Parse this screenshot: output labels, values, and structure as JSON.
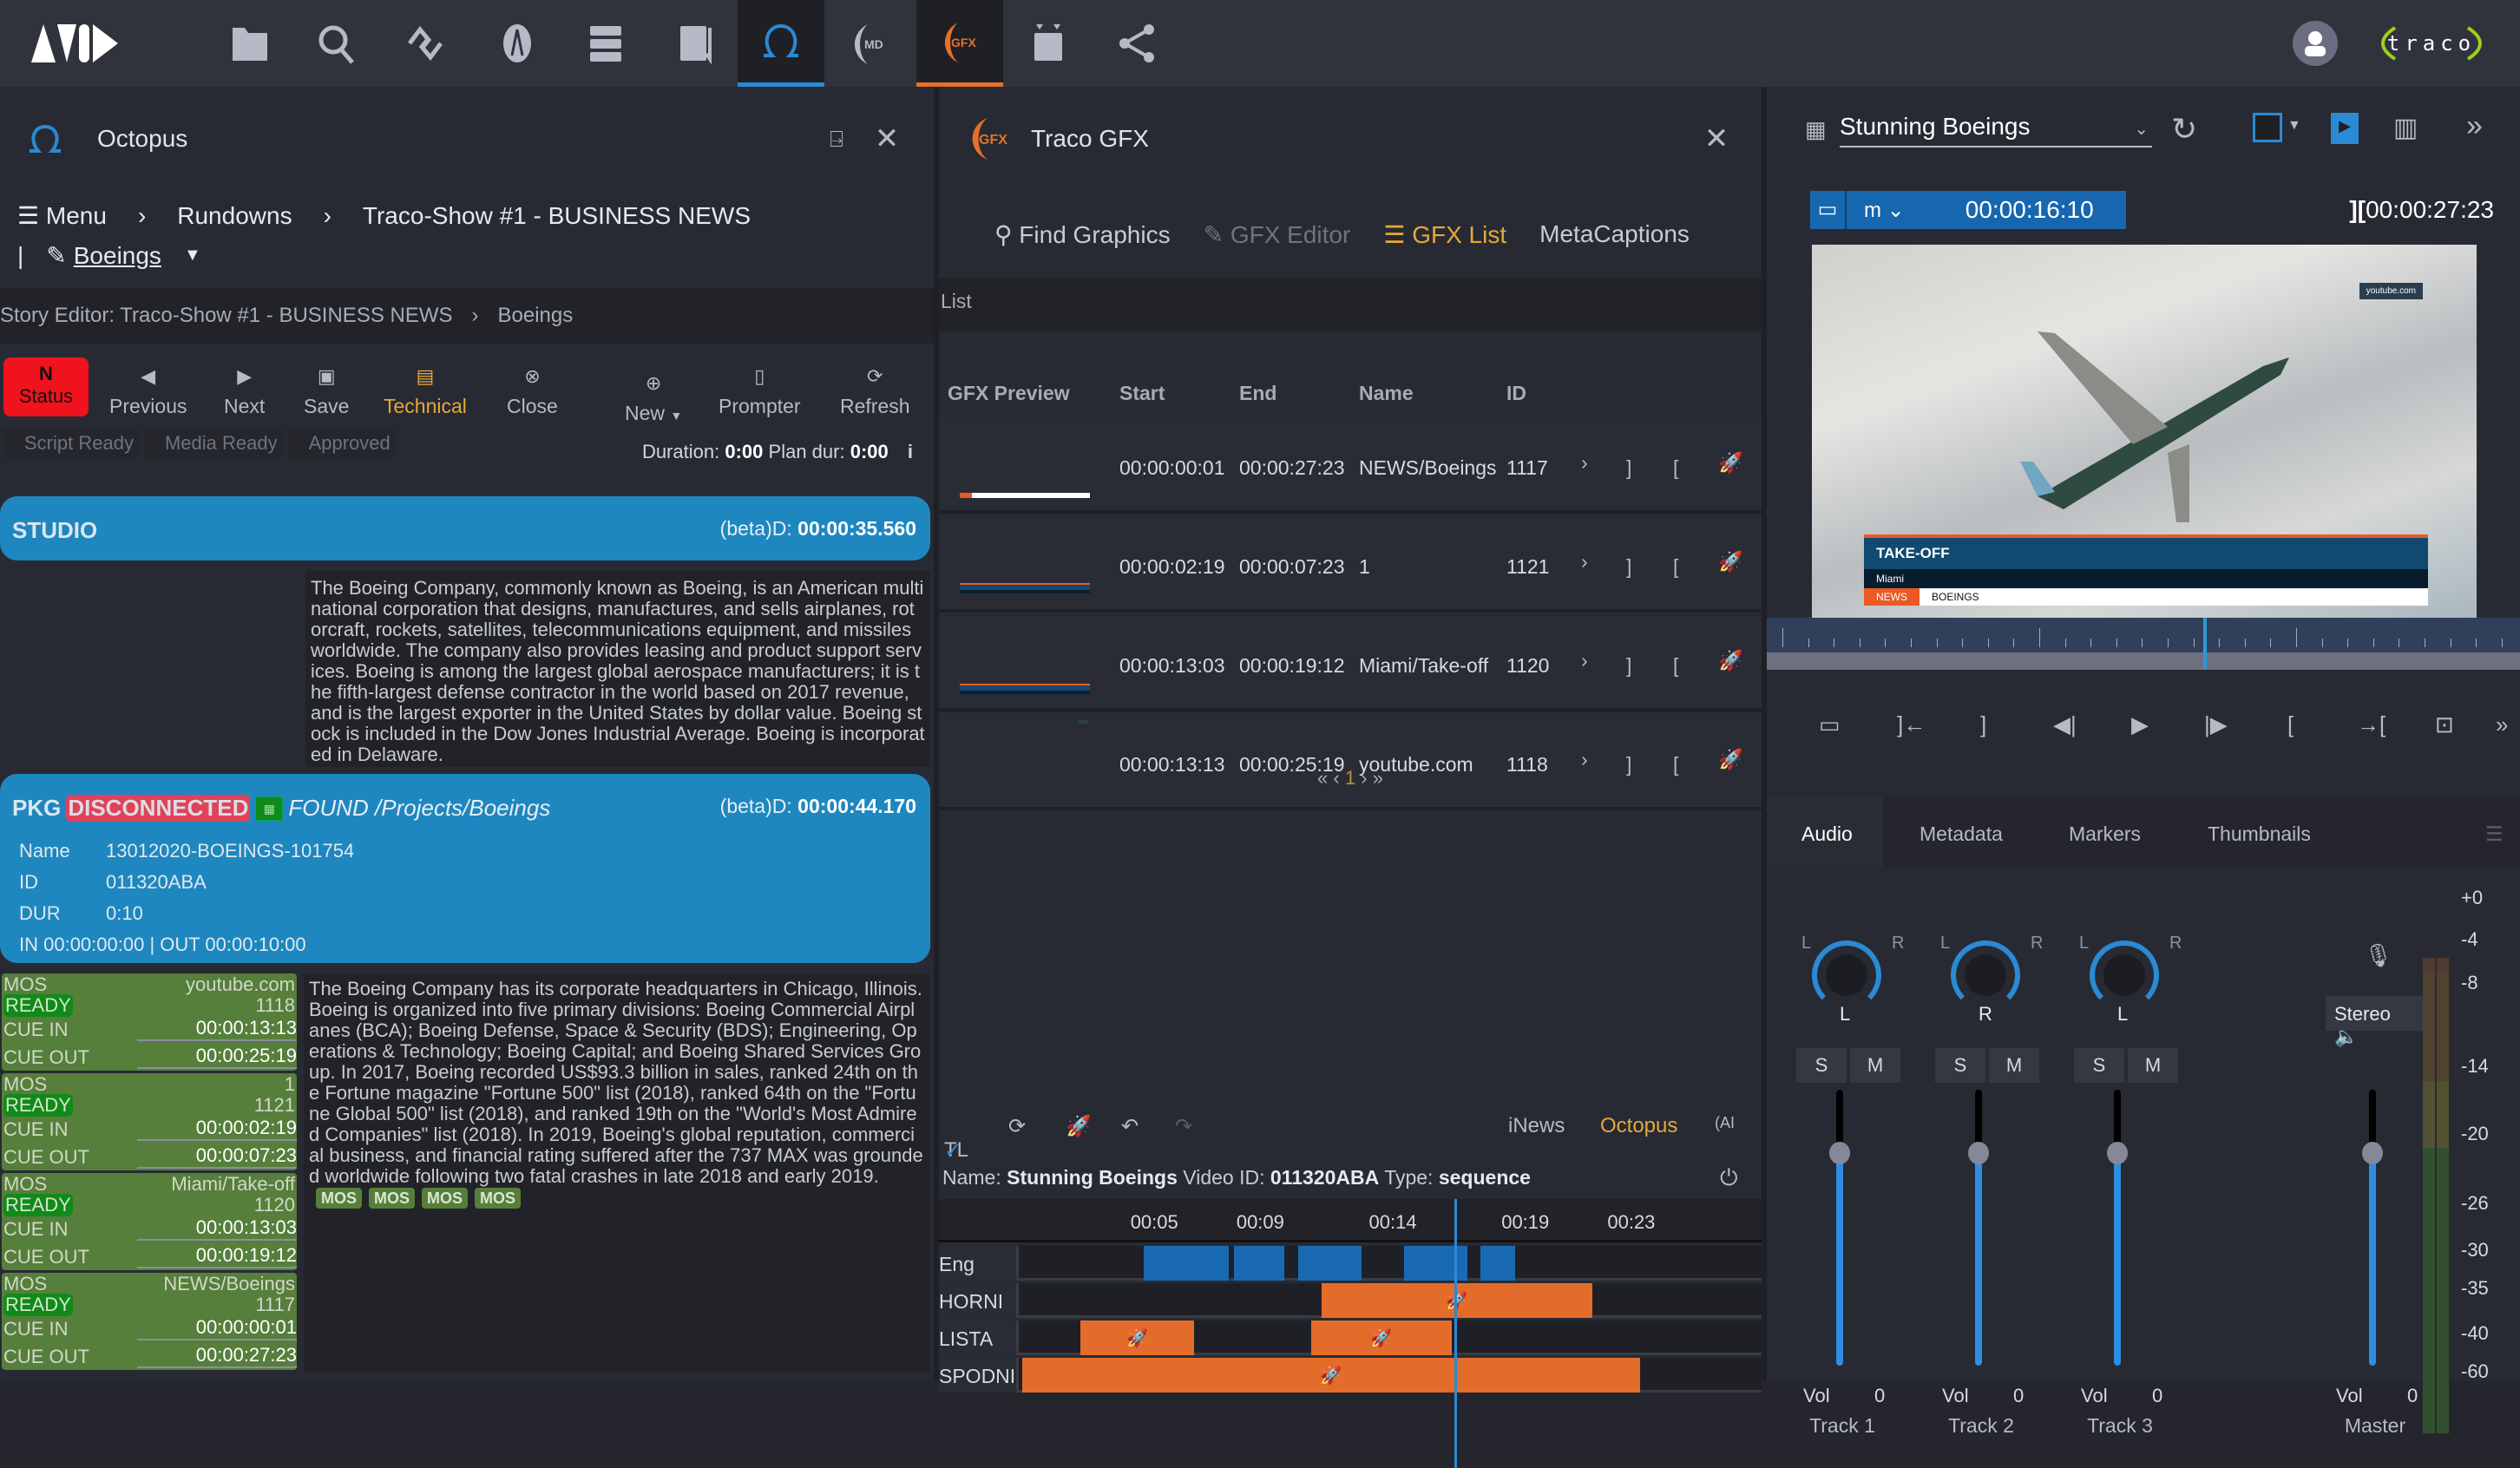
{
  "topbar": {
    "logo": "AVID",
    "nav_icons": [
      {
        "name": "folder-icon"
      },
      {
        "name": "search-icon"
      },
      {
        "name": "link-icon"
      },
      {
        "name": "rocket-icon"
      },
      {
        "name": "storage-icon"
      },
      {
        "name": "log-icon"
      },
      {
        "name": "octopus-icon",
        "active": true,
        "accent": "#2a8ad4"
      },
      {
        "name": "md-icon",
        "label": "MD"
      },
      {
        "name": "gfx-icon",
        "label": "GFX",
        "active": true,
        "accent": "#e4702a"
      },
      {
        "name": "sequence-icon"
      },
      {
        "name": "share-icon"
      }
    ],
    "brand": "traco"
  },
  "octopus": {
    "title": "Octopus",
    "breadcrumb": {
      "menu": "Menu",
      "rundowns": "Rundowns",
      "show": "Traco-Show #1 - BUSINESS NEWS",
      "story": "Boeings"
    },
    "story_editor": {
      "label": "Story Editor: Traco-Show #1 - BUSINESS NEWS",
      "story": "Boeings"
    },
    "toolbar": {
      "status": {
        "letter": "N",
        "label": "Status"
      },
      "previous": "Previous",
      "next": "Next",
      "save": "Save",
      "technical": "Technical",
      "close": "Close",
      "new": "New",
      "prompter": "Prompter",
      "refresh": "Refresh"
    },
    "chips": [
      "Script Ready",
      "Media Ready",
      "Approved"
    ],
    "duration": {
      "label": "Duration:",
      "value": "0:00",
      "plan_label": "Plan dur:",
      "plan_value": "0:00"
    },
    "studio": {
      "title": "STUDIO",
      "beta_label": "(beta)D:",
      "beta_value": "00:00:35.560"
    },
    "script1": "The Boeing Company, commonly known as Boeing, is an American multinational corporation that designs, manufactures, and sells airplanes, rotorcraft, rockets, satellites, telecommunications equipment, and missiles worldwide. The company also provides leasing and product support services. Boeing is among the largest global aerospace manufacturers; it is the fifth-largest defense contractor in the world based on 2017 revenue, and is the largest exporter in the United States by dollar value. Boeing stock is included in the Dow Jones Industrial Average. Boeing is incorporated in Delaware.",
    "pkg": {
      "type": "PKG",
      "status": "DISCONNECTED",
      "found": "FOUND /Projects/Boeings",
      "beta_label": "(beta)D:",
      "beta_value": "00:00:44.170",
      "fields": [
        {
          "k": "Name",
          "v": "13012020-BOEINGS-101754"
        },
        {
          "k": "ID",
          "v": "011320ABA"
        },
        {
          "k": "DUR",
          "v": "0:10"
        }
      ],
      "inout": "IN 00:00:00:00 | OUT 00:00:10:00"
    },
    "mos_items": [
      {
        "type": "MOS",
        "name": "youtube.com",
        "status": "READY",
        "id": "1118",
        "cue_in_label": "CUE IN",
        "cue_in": "00:00:13:13",
        "cue_out_label": "CUE OUT",
        "cue_out": "00:00:25:19"
      },
      {
        "type": "MOS",
        "name": "1",
        "status": "READY",
        "id": "1121",
        "cue_in_label": "CUE IN",
        "cue_in": "00:00:02:19",
        "cue_out_label": "CUE OUT",
        "cue_out": "00:00:07:23"
      },
      {
        "type": "MOS",
        "name": "Miami/Take-off",
        "status": "READY",
        "id": "1120",
        "cue_in_label": "CUE IN",
        "cue_in": "00:00:13:03",
        "cue_out_label": "CUE OUT",
        "cue_out": "00:00:19:12"
      },
      {
        "type": "MOS",
        "name": "NEWS/Boeings",
        "status": "READY",
        "id": "1117",
        "cue_in_label": "CUE IN",
        "cue_in": "00:00:00:01",
        "cue_out_label": "CUE OUT",
        "cue_out": "00:00:27:23"
      }
    ],
    "script2": "The Boeing Company has its corporate headquarters in Chicago, Illinois. Boeing is organized into five primary divisions: Boeing Commercial Airplanes (BCA); Boeing Defense, Space & Security (BDS); Engineering, Operations & Technology; Boeing Capital; and Boeing Shared Services Group. In 2017, Boeing recorded US$93.3 billion in sales, ranked 24th on the Fortune magazine \"Fortune 500\" list (2018), ranked 64th on the \"Fortune Global 500\" list (2018), and ranked 19th on the \"World's Most Admired Companies\" list (2018). In 2019, Boeing's global reputation, commercial business, and financial rating suffered after the 737 MAX was grounded worldwide following two fatal crashes in late 2018 and early 2019.",
    "mos_chips": [
      "MOS",
      "MOS",
      "MOS",
      "MOS"
    ]
  },
  "gfx": {
    "title": "Traco GFX",
    "tabs": [
      {
        "label": "Find Graphics",
        "state": "normal"
      },
      {
        "label": "GFX Editor",
        "state": "disabled"
      },
      {
        "label": "GFX List",
        "state": "active"
      },
      {
        "label": "MetaCaptions",
        "state": "normal"
      }
    ],
    "list_label": "List",
    "columns": [
      "GFX Preview",
      "Start",
      "End",
      "Name",
      "ID"
    ],
    "rows": [
      {
        "start": "00:00:00:01",
        "end": "00:00:27:23",
        "name": "NEWS/Boeings",
        "id": "1117"
      },
      {
        "start": "00:00:02:19",
        "end": "00:00:07:23",
        "name": "1",
        "id": "1121"
      },
      {
        "start": "00:00:13:03",
        "end": "00:00:19:12",
        "name": "Miami/Take-off",
        "id": "1120"
      },
      {
        "start": "00:00:13:13",
        "end": "00:00:25:19",
        "name": "youtube.com",
        "id": "1118"
      }
    ],
    "pager": {
      "first": "«",
      "prev": "‹",
      "current": "1",
      "next": "›",
      "last": "»"
    },
    "timeline": {
      "tl_label": "TL",
      "sources": [
        {
          "label": "iNews",
          "active": false
        },
        {
          "label": "Octopus",
          "active": true
        }
      ],
      "meta": {
        "name_label": "Name:",
        "name": "Stunning Boeings",
        "video_label": "Video ID:",
        "video_id": "011320ABA",
        "type_label": "Type:",
        "type": "sequence"
      },
      "ticks": [
        "00:05",
        "00:09",
        "00:14",
        "00:19",
        "00:23"
      ],
      "range_seconds": [
        0,
        27.9
      ],
      "playhead_seconds": 16.3,
      "tracks": [
        {
          "label": "Eng",
          "color": "blue",
          "segments": [
            [
              4.6,
              7.8
            ],
            [
              8.0,
              9.9
            ],
            [
              10.4,
              12.8
            ],
            [
              14.4,
              16.8
            ],
            [
              17.3,
              18.6
            ]
          ]
        },
        {
          "label": "HORNI",
          "color": "orange",
          "segments": [
            [
              11.3,
              21.5
            ]
          ]
        },
        {
          "label": "LISTA",
          "color": "orange",
          "segments": [
            [
              2.2,
              6.5
            ],
            [
              10.9,
              16.2
            ]
          ]
        },
        {
          "label": "SPODNI",
          "color": "orange",
          "segments": [
            [
              0,
              23.3
            ]
          ]
        }
      ]
    }
  },
  "player": {
    "clip_name": "Stunning Boeings",
    "timecode_mode": "m",
    "timecode": "00:00:16:10",
    "duration": "00:00:27:23",
    "overlay": {
      "watermark": "youtube.com",
      "title": "TAKE-OFF",
      "subtitle": "Miami",
      "tag": "NEWS",
      "keyword": "BOEINGS"
    },
    "playhead_fraction": 0.58,
    "tabs": [
      {
        "label": "Audio",
        "active": true
      },
      {
        "label": "Metadata"
      },
      {
        "label": "Markers"
      },
      {
        "label": "Thumbnails"
      }
    ],
    "channels": [
      {
        "name": "Track 1",
        "pan": "L",
        "solo": "S",
        "mute": "M",
        "vol_label": "Vol",
        "vol": "0"
      },
      {
        "name": "Track 2",
        "pan": "R",
        "solo": "S",
        "mute": "M",
        "vol_label": "Vol",
        "vol": "0"
      },
      {
        "name": "Track 3",
        "pan": "L",
        "solo": "S",
        "mute": "M",
        "vol_label": "Vol",
        "vol": "0"
      }
    ],
    "master": {
      "name": "Master",
      "mode": "Stereo",
      "vol_label": "Vol",
      "vol": "0"
    },
    "meter_scale": [
      "+0",
      "-4",
      "-8",
      "-14",
      "-20",
      "-26",
      "-30",
      "-35",
      "-40",
      "-60"
    ],
    "pan_side_labels": {
      "left": "L",
      "right": "R"
    }
  }
}
